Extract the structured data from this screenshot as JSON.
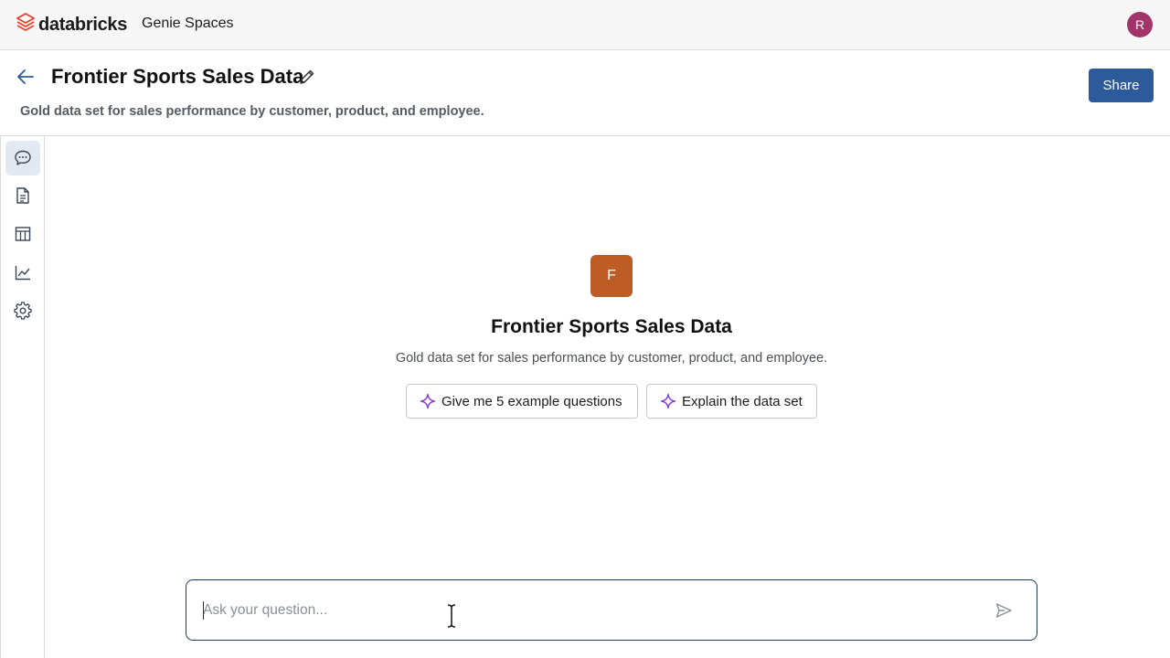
{
  "topbar": {
    "brand": "databricks",
    "app_name": "Genie Spaces",
    "user_initial": "R"
  },
  "header": {
    "title": "Frontier Sports Sales Data",
    "description": "Gold data set for sales performance by customer, product, and employee.",
    "share_label": "Share"
  },
  "sidebar": {
    "items": [
      {
        "icon": "chat-icon",
        "active": true
      },
      {
        "icon": "document-icon",
        "active": false
      },
      {
        "icon": "table-icon",
        "active": false
      },
      {
        "icon": "chart-icon",
        "active": false
      },
      {
        "icon": "gear-icon",
        "active": false
      }
    ]
  },
  "space": {
    "badge_initial": "F",
    "title": "Frontier Sports Sales Data",
    "description": "Gold data set for sales performance by customer, product, and employee.",
    "suggestions": [
      {
        "label": "Give me 5 example questions",
        "icon": "sparkle-icon"
      },
      {
        "label": "Explain the data set",
        "icon": "sparkle-icon"
      }
    ]
  },
  "composer": {
    "placeholder": "Ask your question...",
    "value": ""
  },
  "colors": {
    "accent": "#2d5a9b",
    "badge": "#bd5d25",
    "avatar": "#a3336b",
    "brand_logo": "#e8442f",
    "sparkle": "#8a3fd1"
  }
}
